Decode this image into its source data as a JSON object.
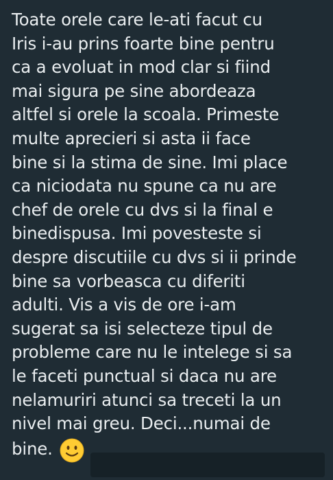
{
  "message": {
    "lines": [
      "Toate orele care le-ati facut cu",
      "Iris i-au prins foarte bine pentru",
      "ca a evoluat in mod clar si fiind",
      "mai sigura pe sine abordeaza",
      "altfel si orele la scoala. Primeste",
      "multe aprecieri si asta ii face",
      "bine si la stima de sine. Imi place",
      "ca niciodata nu spune ca nu are",
      "chef de orele cu dvs si la final e",
      "binedispusa. Imi povesteste si",
      "despre discutiile cu dvs si ii prinde",
      "bine sa vorbeasca cu diferiti",
      "adulti. Vis a vis de ore i-am",
      "sugerat sa isi selecteze tipul de",
      "probleme care nu le intelege si sa",
      "le faceti punctual si daca nu are",
      "nelamuriri atunci sa treceti la un",
      "nivel mai greu. Deci...numai de",
      "bine."
    ],
    "emoji": "slightly-smiling-face",
    "colors": {
      "bubble": "#1f2c34",
      "text": "#e9edef",
      "redacted": "#162127",
      "emoji_face": "#ffcc33"
    }
  }
}
